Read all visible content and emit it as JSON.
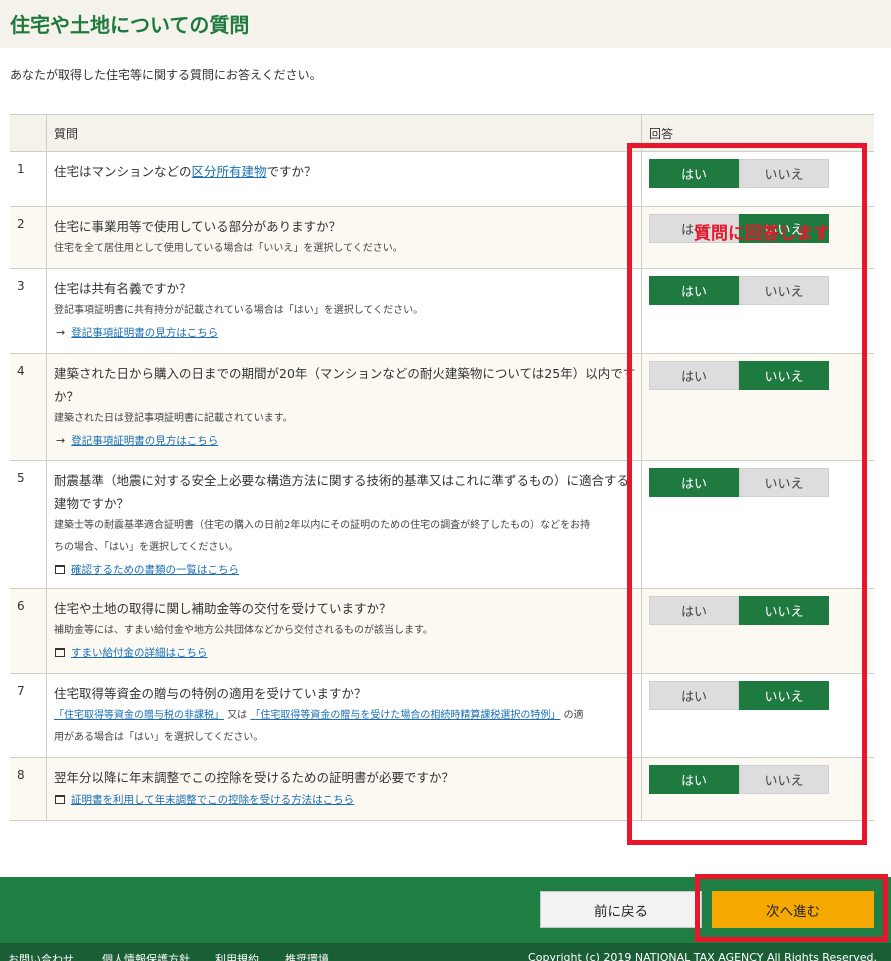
{
  "page": {
    "title": "住宅や土地についての質問",
    "intro": "あなたが取得した住宅等に関する質問にお答えください。"
  },
  "table": {
    "header_question": "質問",
    "header_answer": "回答",
    "yes_label": "はい",
    "no_label": "いいえ",
    "rows": [
      {
        "num": "1",
        "text_before": "住宅はマンションなどの",
        "text_link": "区分所有建物",
        "text_after": "ですか？",
        "answer": "yes"
      },
      {
        "num": "2",
        "text": "住宅に事業用等で使用している部分がありますか？",
        "note": "住宅を全て居住用として使用している場合は「いいえ」を選択してください。",
        "answer": "no"
      },
      {
        "num": "3",
        "text": "住宅は共有名義ですか？",
        "note": "登記事項証明書に共有持分が記載されている場合は「はい」を選択してください。",
        "link": "登記事項証明書の見方はこちら",
        "answer": "yes"
      },
      {
        "num": "4",
        "text": "建築された日から購入の日までの期間が20年（マンションなどの耐火建築物については25年）以内ですか？",
        "note": "建築された日は登記事項証明書に記載されています。",
        "link": "登記事項証明書の見方はこちら",
        "answer": "no"
      },
      {
        "num": "5",
        "text": "耐震基準（地震に対する安全上必要な構造方法に関する技術的基準又はこれに準ずるもの）に適合する建物ですか？",
        "note": "建築士等の耐震基準適合証明書（住宅の購入の日前2年以内にその証明のための住宅の調査が終了したもの）などをお持",
        "note2": "ちの場合、「はい」を選択してください。",
        "link": "確認するための書類の一覧はこちら",
        "answer": "yes"
      },
      {
        "num": "6",
        "text": "住宅や土地の取得に関し補助金等の交付を受けていますか？",
        "note": "補助金等には、すまい給付金や地方公共団体などから交付されるものが該当します。",
        "link": "すまい給付金の詳細はこちら",
        "answer": "no"
      },
      {
        "num": "7",
        "text": "住宅取得等資金の贈与の特例の適用を受けていますか？",
        "note_link1": "「住宅取得等資金の贈与税の非課税」",
        "note_mid": "又は",
        "note_link2": "「住宅取得等資金の贈与を受けた場合の相続時精算課税選択の特例」",
        "note_tail": "の適",
        "note2": "用がある場合は「はい」を選択してください。",
        "answer": "no"
      },
      {
        "num": "8",
        "text": "翌年分以降に年末調整でこの控除を受けるための証明書が必要ですか？",
        "link": "証明書を利用して年末調整でこの控除を受ける方法はこちら",
        "answer": "yes"
      }
    ]
  },
  "annotation": {
    "label": "質問に回答します",
    "color": "#e8162a"
  },
  "nav": {
    "back_label": "前に戻る",
    "next_label": "次へ進む"
  },
  "footer": {
    "links": [
      "お問い合わせ",
      "個人情報保護方針",
      "利用規約",
      "推奨環境"
    ],
    "copyright": "Copyright (c) 2019 NATIONAL TAX AGENCY All Rights Reserved."
  },
  "colors": {
    "brand_green": "#1f7a3f",
    "next_button": "#f5a800",
    "header_bg": "#f4f2ea"
  }
}
